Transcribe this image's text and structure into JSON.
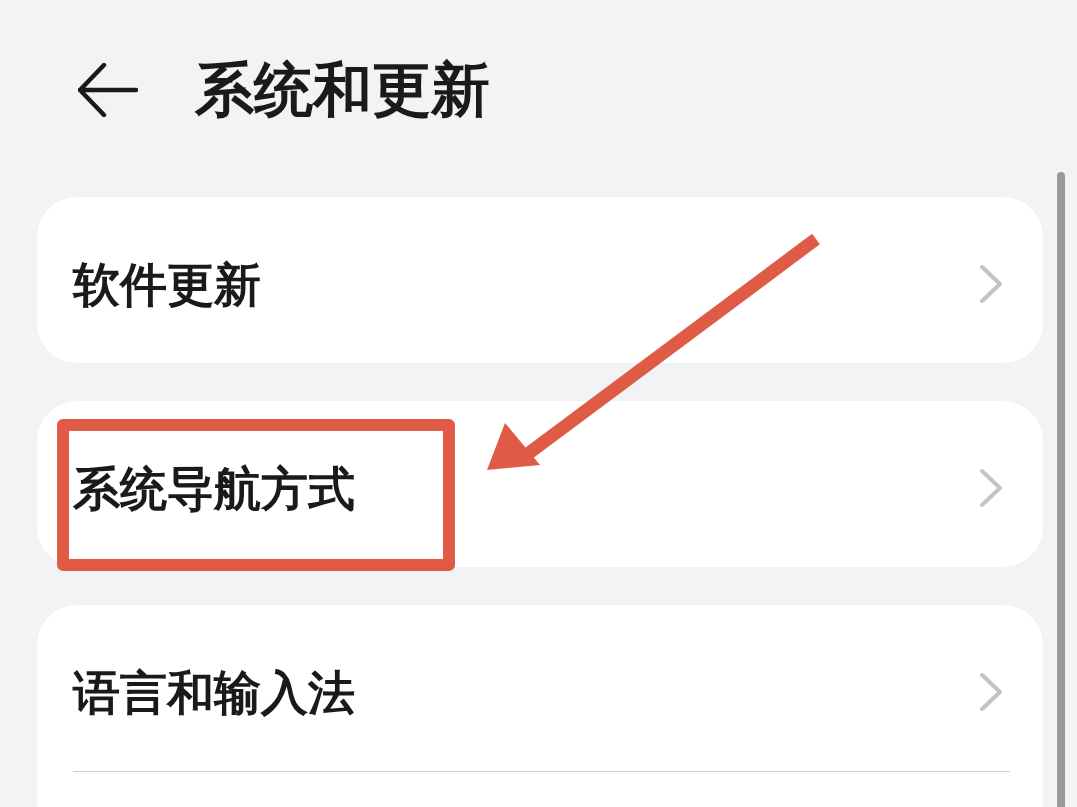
{
  "header": {
    "title": "系统和更新"
  },
  "groups": [
    {
      "cut_off": false,
      "items": [
        {
          "label": "软件更新",
          "highlighted": false
        }
      ]
    },
    {
      "cut_off": false,
      "items": [
        {
          "label": "系统导航方式",
          "highlighted": true
        }
      ]
    },
    {
      "cut_off": true,
      "items": [
        {
          "label": "语言和输入法",
          "highlighted": false
        }
      ]
    }
  ]
}
